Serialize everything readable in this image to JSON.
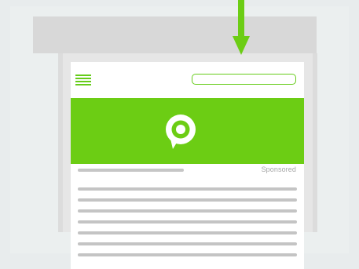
{
  "colors": {
    "accent": "#6ccd14",
    "background": "#e8eced",
    "placeholder_line": "#c4c4c4"
  },
  "icons": {
    "arrow": "arrow-down-icon",
    "menu": "hamburger-menu-icon",
    "logo": "location-pin-chat-icon"
  },
  "header": {
    "search_placeholder": ""
  },
  "ad": {
    "sponsored_label": "Sponsored"
  },
  "content": {
    "text_line_count": 7
  }
}
